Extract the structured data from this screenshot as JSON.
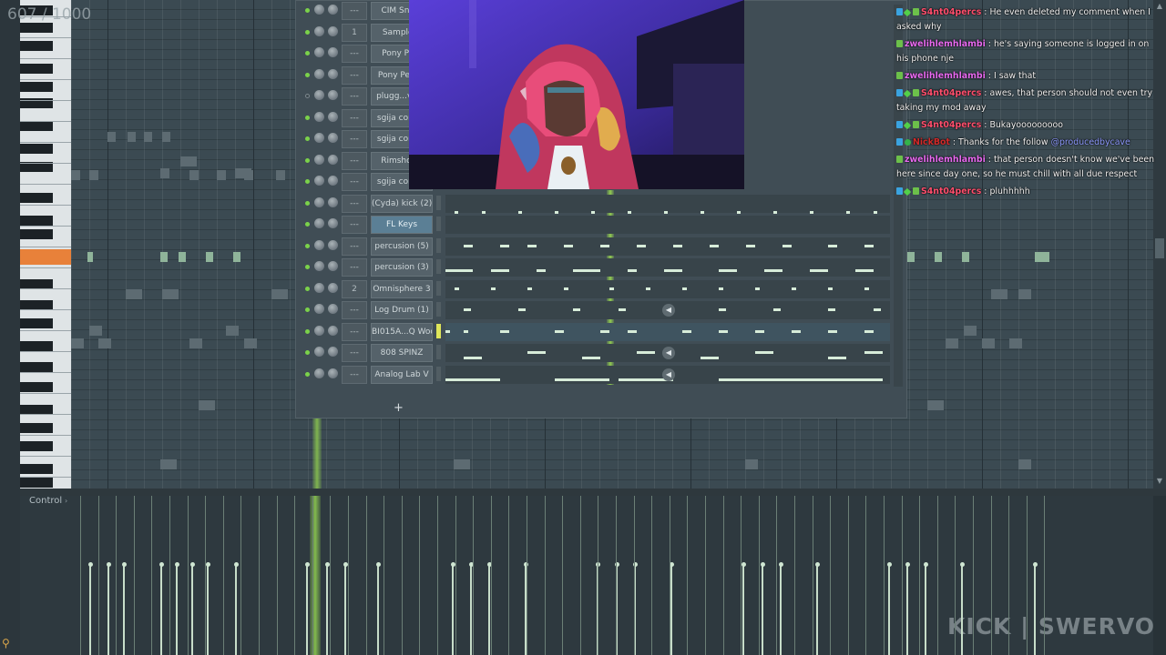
{
  "counter": "607 / 1000",
  "watermark": "KICK | SWERVO",
  "control_pane": {
    "label": "Control",
    "arrow": "›"
  },
  "zoom_icon": "magnifier-icon",
  "rack": {
    "add_symbol": "+",
    "channels": [
      {
        "name": "CIM Sna...",
        "route": "---",
        "led": "on"
      },
      {
        "name": "Sample...",
        "route": "1",
        "led": "on"
      },
      {
        "name": "Pony Pe...",
        "route": "---",
        "led": "on"
      },
      {
        "name": "Pony Perc...",
        "route": "---",
        "led": "on"
      },
      {
        "name": "plugg...val...",
        "route": "---",
        "led": "off"
      },
      {
        "name": "sgija cong...",
        "route": "---",
        "led": "on"
      },
      {
        "name": "sgija cong...",
        "route": "---",
        "led": "on"
      },
      {
        "name": "Rimshot...",
        "route": "---",
        "led": "on"
      },
      {
        "name": "sgija cong...",
        "route": "---",
        "led": "on"
      },
      {
        "name": "(Cyda) kick (2)",
        "route": "---",
        "led": "on"
      },
      {
        "name": "FL Keys",
        "route": "---",
        "led": "on",
        "selected": true
      },
      {
        "name": "percusion (5)",
        "route": "---",
        "led": "on"
      },
      {
        "name": "percusion (3)",
        "route": "---",
        "led": "on"
      },
      {
        "name": "Omnisphere 3",
        "route": "2",
        "led": "on"
      },
      {
        "name": "Log Drum (1)",
        "route": "---",
        "led": "on"
      },
      {
        "name": "BI015A...Q Wood",
        "route": "---",
        "led": "on",
        "active": true
      },
      {
        "name": "808 SPINZ",
        "route": "---",
        "led": "on"
      },
      {
        "name": "Analog Lab V",
        "route": "---",
        "led": "on"
      }
    ]
  },
  "chat": [
    {
      "user": "S4nt04percs",
      "user_color": "#ff4f6d",
      "badges": [
        "mod",
        "vip",
        "sub"
      ],
      "text": "He even deleted my comment when I asked why"
    },
    {
      "user": "zwelihlemhlambi",
      "user_color": "#e86af0",
      "badges": [
        "sub"
      ],
      "text": "he's saying someone is logged in on his phone nje"
    },
    {
      "user": "zwelihlemhlambi",
      "user_color": "#e86af0",
      "badges": [
        "sub"
      ],
      "text": "I saw that"
    },
    {
      "user": "S4nt04percs",
      "user_color": "#ff4f6d",
      "badges": [
        "mod",
        "vip",
        "sub"
      ],
      "text": "awes, that person should not even try taking my mod away"
    },
    {
      "user": "S4nt04percs",
      "user_color": "#ff4f6d",
      "badges": [
        "mod",
        "vip",
        "sub"
      ],
      "text": "Bukayooooooooo"
    },
    {
      "user": "NickBot",
      "user_color": "#d22a2a",
      "badges": [
        "mod",
        "verified"
      ],
      "text": "Thanks for the follow ",
      "mention": "@producedbycave"
    },
    {
      "user": "zwelihlemhlambi",
      "user_color": "#e86af0",
      "badges": [
        "sub"
      ],
      "text": "that person doesn't know we've been here since day one, so he must chill with all due respect"
    },
    {
      "user": "S4nt04percs",
      "user_color": "#ff4f6d",
      "badges": [
        "mod",
        "vip",
        "sub"
      ],
      "text": "pluhhhhh"
    }
  ],
  "colors": {
    "accent_green": "#7bd24a",
    "note_light": "#d7ecd9",
    "c5_key": "#e8813a"
  }
}
